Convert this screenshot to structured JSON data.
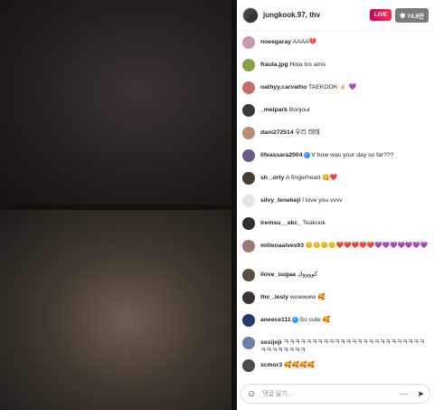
{
  "header": {
    "host_name": "jungkook.97, thv",
    "live_label": "LIVE",
    "viewer_count": "74.9만"
  },
  "comments": [
    {
      "user": "noeegaray",
      "text": "AAAA💔",
      "avatar_color": "#c89aa8"
    },
    {
      "user": "fraula.jpg",
      "text": "Hola los amo",
      "avatar_color": "#8aa04a"
    },
    {
      "user": "nathyy.carvalho",
      "text": "TAEKOOK ✌🏻 💜",
      "avatar_color": "#c26f6a"
    },
    {
      "user": "_meipark",
      "text": "Bonjour",
      "avatar_color": "#3a3a3a"
    },
    {
      "user": "dani272514",
      "text": "우리 태태",
      "avatar_color": "#b98e76"
    },
    {
      "user": "lifeassara2004",
      "text": "V how was your day so far???",
      "verified": true,
      "avatar_color": "#6d5a8a"
    },
    {
      "user": "sh_.orty",
      "text": "A fingerheart 😋❤️",
      "avatar_color": "#4b3c33"
    },
    {
      "user": "silvy_tenekeji",
      "text": "I love you vvvv",
      "avatar_color": "#e5e5e5"
    },
    {
      "user": "iremsu__ekc_",
      "text": "Teakook",
      "avatar_color": "#2f2f2f"
    },
    {
      "user": "millenaalves93",
      "text": "😊😊😊😊❤️❤️❤️❤️❤️💜💜💜💜💜💜💜",
      "avatar_color": "#9a7a6d",
      "tall": true
    },
    {
      "user": "ilove_sugaa",
      "text": "كووووك",
      "avatar_color": "#5b4f45"
    },
    {
      "user": "thv_.lesly",
      "text": "wowwww 🥰",
      "avatar_color": "#3f3432"
    },
    {
      "user": "aneece111",
      "text": "So cute 🥰",
      "verified": true,
      "avatar_color": "#243a6b"
    },
    {
      "user": "sosijoji",
      "text": "ㅋㅋㅋㅋㅋㅋㅋㅋㅋㅋㅋㅋㅋㅋㅋㅋㅋㅋㅋㅋㅋㅋㅋㅋㅋㅋㅋㅋㅋㅋㅋㅋㅋ",
      "avatar_color": "#6a7ea8"
    },
    {
      "user": "scmor3",
      "text": "🥰🥰🥰🥰",
      "avatar_color": "#4a4a4a"
    }
  ],
  "composer": {
    "placeholder": "댓글 달기...",
    "emoji_icon": "☺",
    "more_icon": "⋯",
    "send_icon": "➤"
  }
}
